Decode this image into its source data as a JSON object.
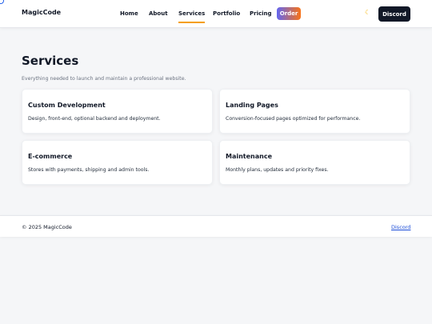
{
  "header": {
    "brand": "MagicCode",
    "nav": [
      {
        "label": "Home",
        "active": false
      },
      {
        "label": "About",
        "active": false
      },
      {
        "label": "Services",
        "active": true
      },
      {
        "label": "Portfolio",
        "active": false
      },
      {
        "label": "Pricing",
        "active": false
      }
    ],
    "order_label": "Order",
    "theme_icon": "moon-icon",
    "discord_label": "Discord"
  },
  "main": {
    "title": "Services",
    "subtitle": "Everything needed to launch and maintain a professional website.",
    "cards": [
      {
        "title": "Custom Development",
        "description": "Design, front-end, optional backend and deployment."
      },
      {
        "title": "Landing Pages",
        "description": "Conversion-focused pages optimized for performance."
      },
      {
        "title": "E-commerce",
        "description": "Stores with payments, shipping and admin tools."
      },
      {
        "title": "Maintenance",
        "description": "Monthly plans, updates and priority fixes."
      }
    ]
  },
  "footer": {
    "copyright": "© 2025 MagicCode",
    "link_label": "Discord"
  },
  "colors": {
    "accent_underline": "#f59e0b",
    "order_gradient_start": "#6366f1",
    "order_gradient_end": "#f97316",
    "discord_button": "#111827",
    "link": "#1d4ed8",
    "background": "#f5f6f8"
  }
}
